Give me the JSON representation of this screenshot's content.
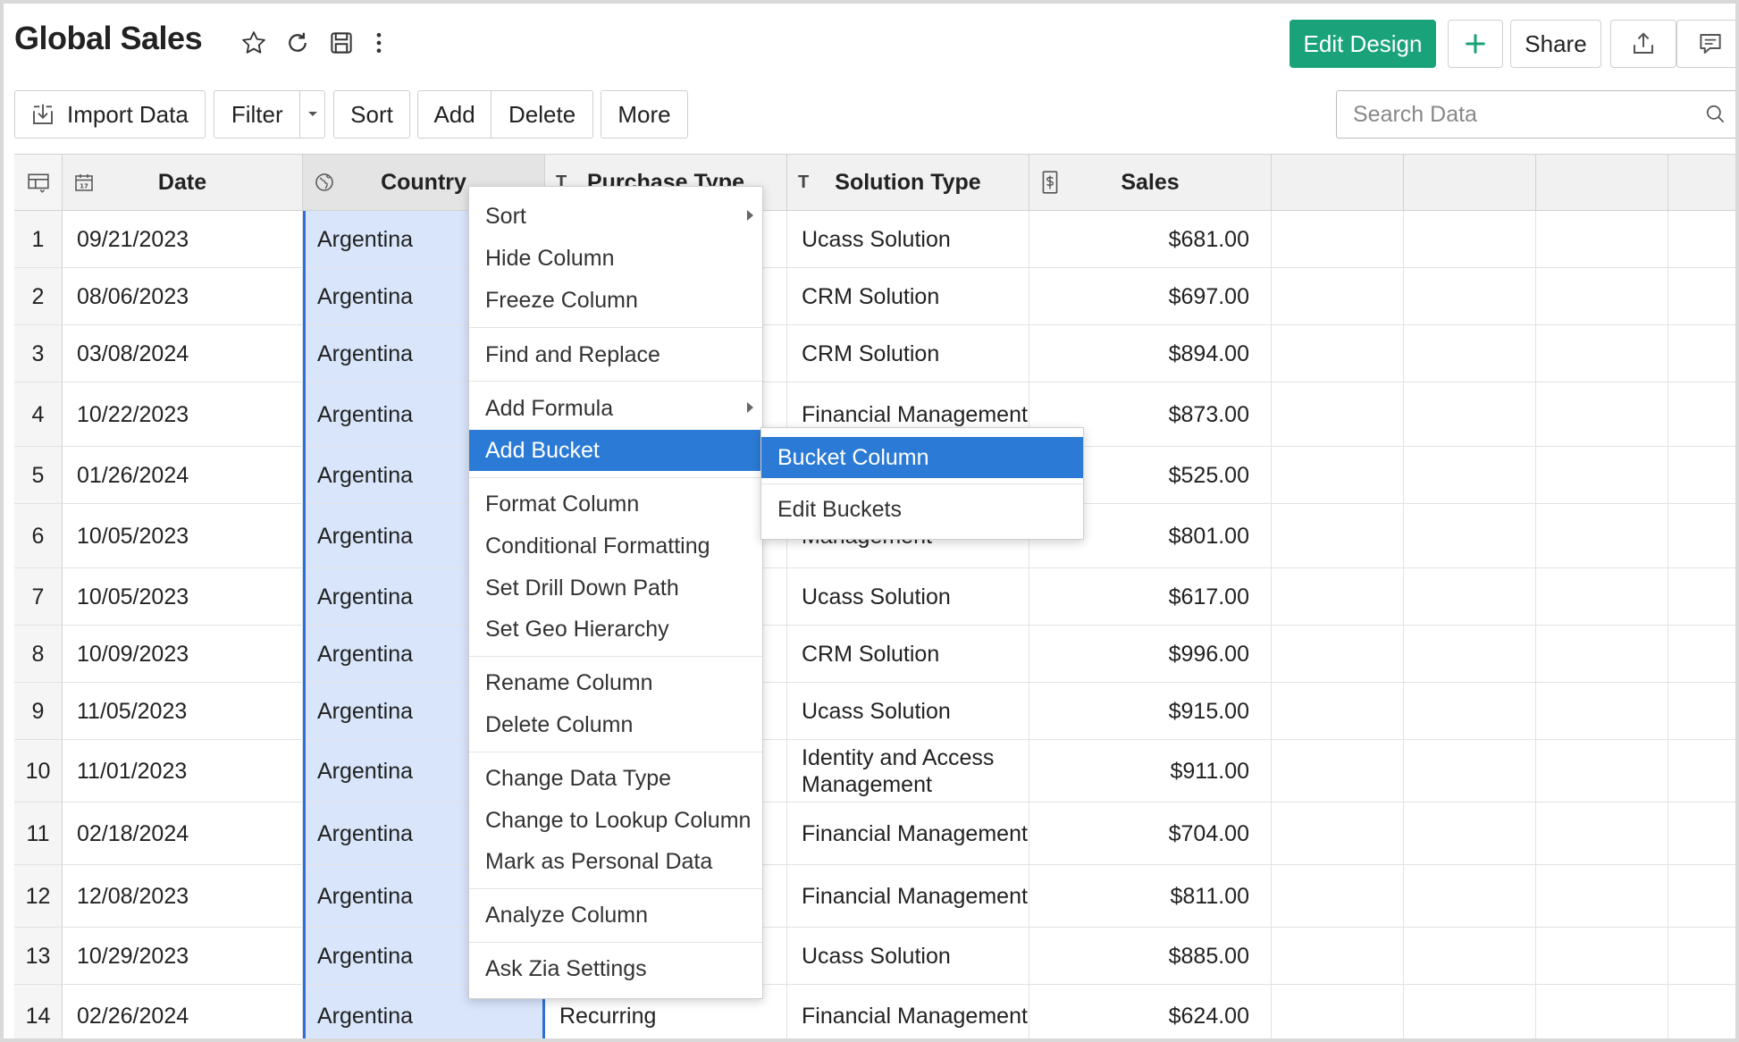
{
  "header": {
    "title": "Global Sales",
    "edit_design_label": "Edit Design",
    "share_label": "Share"
  },
  "toolbar": {
    "import_label": "Import Data",
    "filter_label": "Filter",
    "sort_label": "Sort",
    "add_label": "Add",
    "delete_label": "Delete",
    "more_label": "More"
  },
  "search": {
    "placeholder": "Search Data"
  },
  "columns": {
    "date": "Date",
    "country": "Country",
    "purchase_type": "Purchase Type",
    "solution_type": "Solution Type",
    "sales": "Sales"
  },
  "rows": [
    {
      "n": "1",
      "date": "09/21/2023",
      "country": "Argentina",
      "purchase": "",
      "solution": "Ucass Solution",
      "sales": "$681.00"
    },
    {
      "n": "2",
      "date": "08/06/2023",
      "country": "Argentina",
      "purchase": "",
      "solution": "CRM Solution",
      "sales": "$697.00"
    },
    {
      "n": "3",
      "date": "03/08/2024",
      "country": "Argentina",
      "purchase": "",
      "solution": "CRM Solution",
      "sales": "$894.00"
    },
    {
      "n": "4",
      "date": "10/22/2023",
      "country": "Argentina",
      "purchase": "",
      "solution": "Financial Management",
      "sales": "$873.00"
    },
    {
      "n": "5",
      "date": "01/26/2024",
      "country": "Argentina",
      "purchase": "",
      "solution": "",
      "sales": "$525.00"
    },
    {
      "n": "6",
      "date": "10/05/2023",
      "country": "Argentina",
      "purchase": "",
      "solution": "Management",
      "sales": "$801.00"
    },
    {
      "n": "7",
      "date": "10/05/2023",
      "country": "Argentina",
      "purchase": "",
      "solution": "Ucass Solution",
      "sales": "$617.00"
    },
    {
      "n": "8",
      "date": "10/09/2023",
      "country": "Argentina",
      "purchase": "",
      "solution": "CRM Solution",
      "sales": "$996.00"
    },
    {
      "n": "9",
      "date": "11/05/2023",
      "country": "Argentina",
      "purchase": "",
      "solution": "Ucass Solution",
      "sales": "$915.00"
    },
    {
      "n": "10",
      "date": "11/01/2023",
      "country": "Argentina",
      "purchase": "",
      "solution": "Identity and Access Management",
      "sales": "$911.00"
    },
    {
      "n": "11",
      "date": "02/18/2024",
      "country": "Argentina",
      "purchase": "",
      "solution": "Financial Management",
      "sales": "$704.00"
    },
    {
      "n": "12",
      "date": "12/08/2023",
      "country": "Argentina",
      "purchase": "",
      "solution": "Financial Management",
      "sales": "$811.00"
    },
    {
      "n": "13",
      "date": "10/29/2023",
      "country": "Argentina",
      "purchase": "",
      "solution": "Ucass Solution",
      "sales": "$885.00"
    },
    {
      "n": "14",
      "date": "02/26/2024",
      "country": "Argentina",
      "purchase": "Recurring",
      "solution": "Financial Management",
      "sales": "$624.00"
    }
  ],
  "context_menu": {
    "items": [
      {
        "label": "Sort"
      },
      {
        "label": "Hide Column"
      },
      {
        "label": "Freeze Column"
      },
      {
        "label": "Find and Replace"
      },
      {
        "label": "Add Formula"
      },
      {
        "label": "Add Bucket"
      },
      {
        "label": "Format Column"
      },
      {
        "label": "Conditional Formatting"
      },
      {
        "label": "Set Drill Down Path"
      },
      {
        "label": "Set Geo Hierarchy"
      },
      {
        "label": "Rename Column"
      },
      {
        "label": "Delete Column"
      },
      {
        "label": "Change Data Type"
      },
      {
        "label": "Change to Lookup Column"
      },
      {
        "label": "Mark as Personal Data"
      },
      {
        "label": "Analyze Column"
      },
      {
        "label": "Ask Zia Settings"
      }
    ],
    "active_item": "Add Bucket"
  },
  "submenu": {
    "items": [
      {
        "label": "Bucket Column"
      },
      {
        "label": "Edit Buckets"
      }
    ],
    "active_item": "Bucket Column"
  },
  "colors": {
    "accent": "#1aa37a",
    "menu_highlight": "#2b7bd6",
    "selected_column": "#d8e5fb"
  }
}
